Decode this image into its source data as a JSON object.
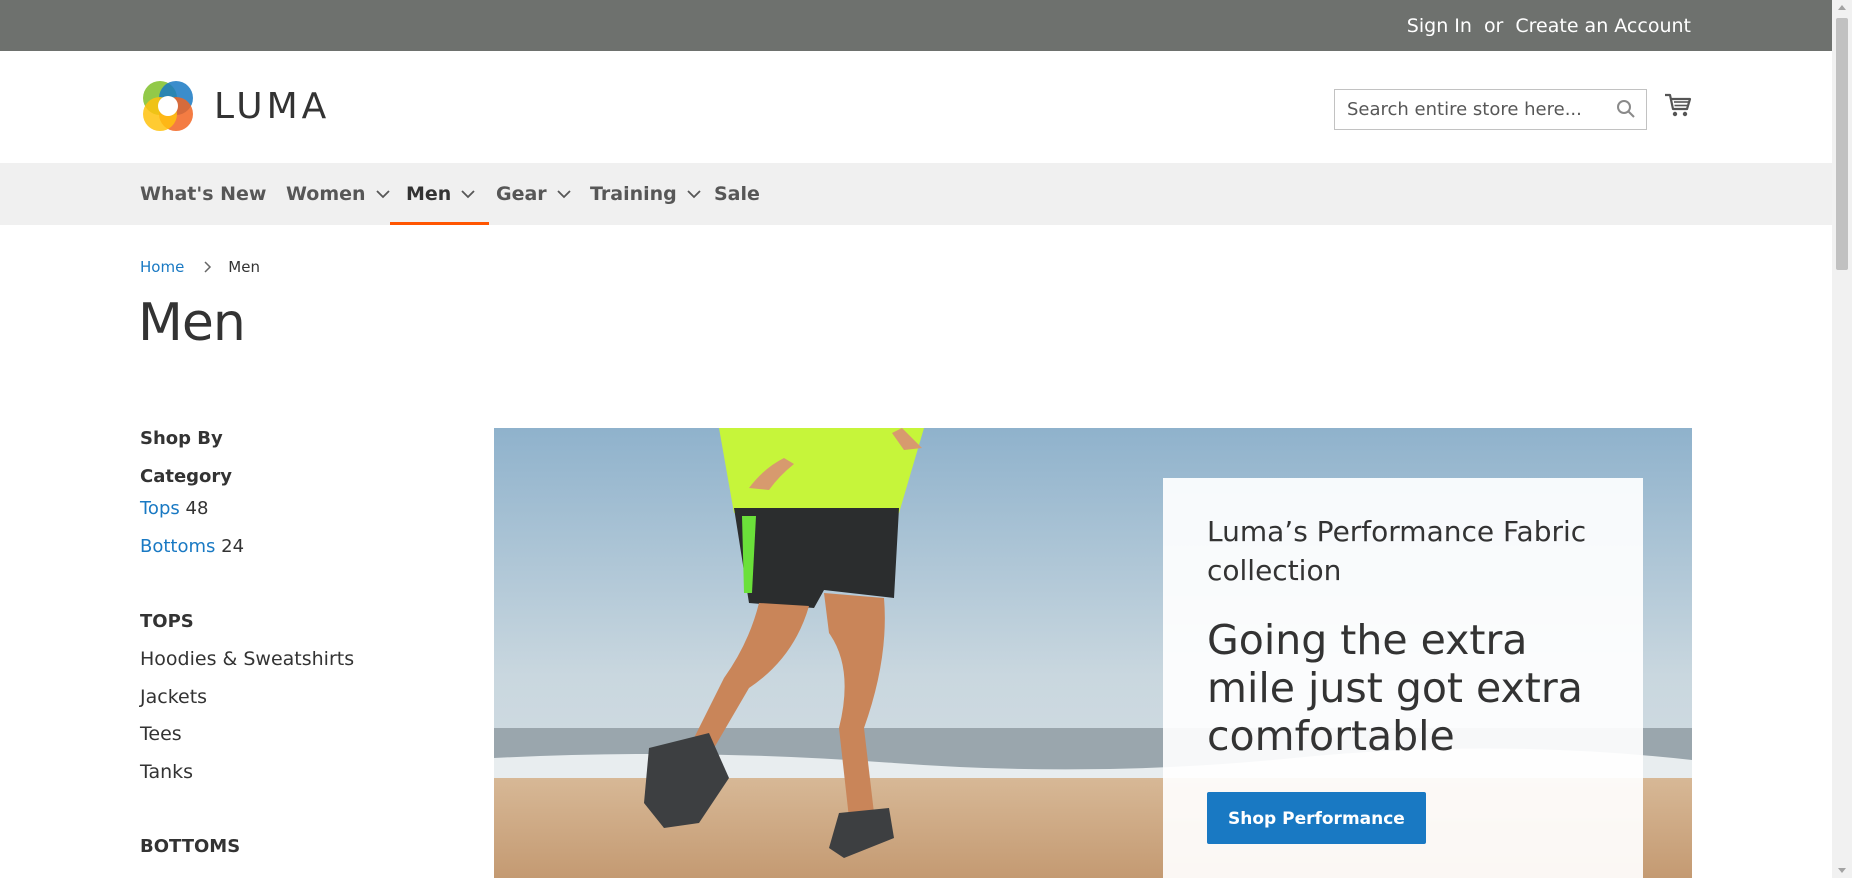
{
  "topbar": {
    "sign_in": "Sign In",
    "or": "or",
    "create_account": "Create an Account"
  },
  "header": {
    "logo_text": "LUMA",
    "search_placeholder": "Search entire store here...",
    "search_icon": "search-icon",
    "cart_icon": "cart-icon"
  },
  "nav": {
    "items": [
      {
        "label": "What's New"
      },
      {
        "label": "Women"
      },
      {
        "label": "Men"
      },
      {
        "label": "Gear"
      },
      {
        "label": "Training"
      },
      {
        "label": "Sale"
      }
    ],
    "active": "Men"
  },
  "breadcrumb": {
    "home": "Home",
    "current": "Men"
  },
  "page": {
    "title": "Men"
  },
  "sidebar": {
    "shop_by": "Shop By",
    "category_heading": "Category",
    "categories": [
      {
        "label": "Tops",
        "count": "48"
      },
      {
        "label": "Bottoms",
        "count": "24"
      }
    ],
    "tops_heading": "TOPS",
    "tops": [
      "Hoodies & Sweatshirts",
      "Jackets",
      "Tees",
      "Tanks"
    ],
    "bottoms_heading": "BOTTOMS"
  },
  "hero": {
    "subtitle": "Luma’s Performance Fabric collection",
    "headline": "Going the extra mile just got extra comfortable",
    "button": "Shop Performance"
  },
  "colors": {
    "accent": "#1979c3",
    "nav_active": "#ff5501",
    "topbar": "#6e716e"
  }
}
